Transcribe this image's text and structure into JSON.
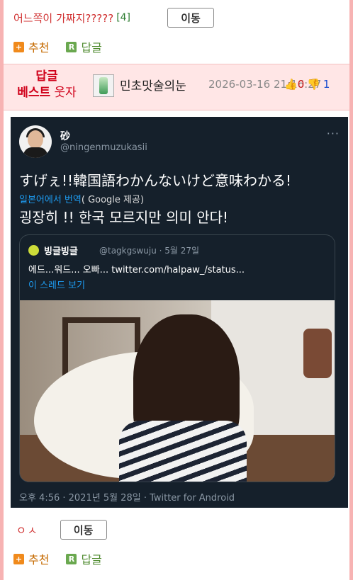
{
  "reply": {
    "title": "어느쪽이 가짜지?????",
    "count": "[4]",
    "move_label": "이동",
    "recommend_label": "추천",
    "answer_label": "답글"
  },
  "best_post": {
    "badge_line1": "답글",
    "badge_line2_bold": "베스트",
    "badge_line2": "웃자",
    "nickname": "민초맛술의눈",
    "date": "2026-03-16 21:16:27",
    "up_count": "0",
    "down_count": "1"
  },
  "tweet": {
    "name": "砂",
    "handle": "@ningenmuzukasii",
    "jp_text": "すげぇ!!韓国語わかんないけど意味わかる!",
    "translate_prefix": "일본어에서 번역",
    "translate_google": "( Google",
    "translate_suffix": "제공)",
    "ko_text": "굉장히 !! 한국 모르지만 의미 안다!",
    "quote_name": "빙글빙글",
    "quote_meta": "@tagkgswuju · 5월 27일",
    "quote_text": "에드...워드... 오빠...  twitter.com/halpaw_/status...",
    "quote_thread": "이 스레드 보기",
    "footer": "오후 4:56 · 2021년 5월 28일 · Twitter for Android",
    "more": "···"
  },
  "comment2": {
    "text": "ㅇㅅ",
    "move_label": "이동",
    "recommend_label": "추천",
    "answer_label": "답글"
  }
}
